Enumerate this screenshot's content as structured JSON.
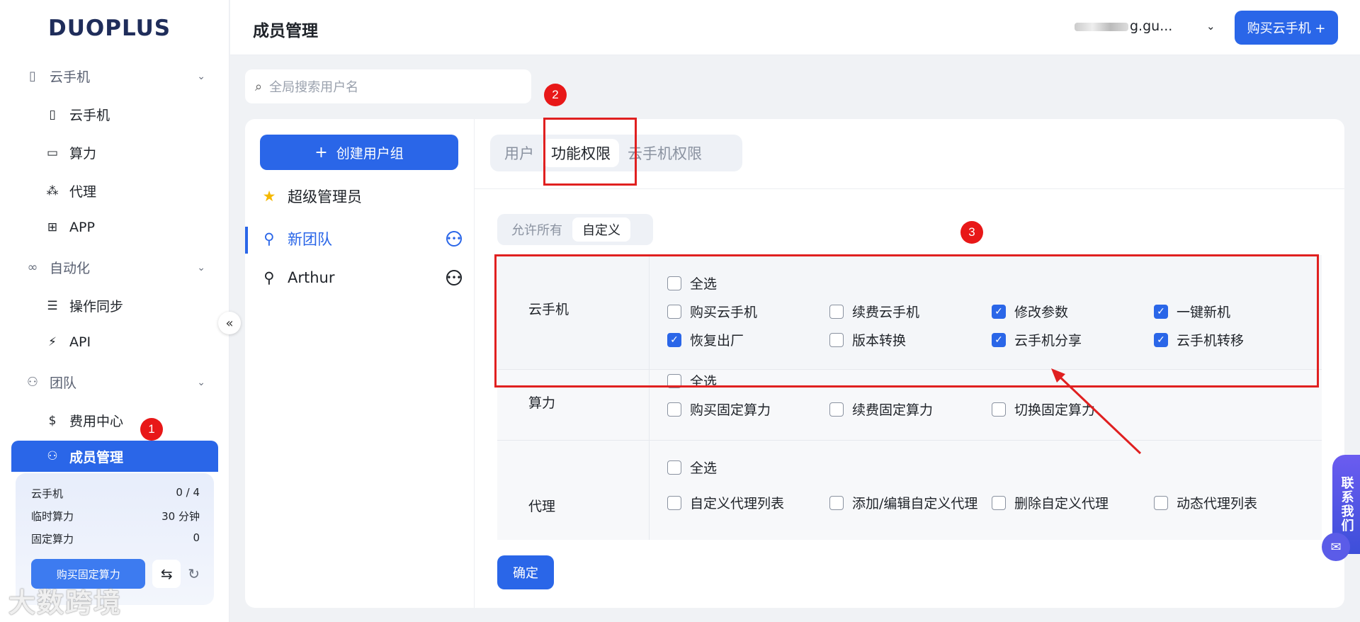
{
  "app": {
    "logo": "DUOPLUS"
  },
  "sidebar": {
    "groups": [
      {
        "label": "云手机",
        "items": [
          {
            "label": "云手机"
          },
          {
            "label": "算力"
          },
          {
            "label": "代理"
          },
          {
            "label": "APP"
          }
        ]
      },
      {
        "label": "自动化",
        "items": [
          {
            "label": "操作同步"
          },
          {
            "label": "API"
          }
        ]
      },
      {
        "label": "团队",
        "items": [
          {
            "label": "费用中心"
          },
          {
            "label": "成员管理"
          }
        ]
      }
    ],
    "collapse_icon": "«"
  },
  "quota": {
    "rows": [
      {
        "label": "云手机",
        "value": "0 / 4"
      },
      {
        "label": "临时算力",
        "value": "30 分钟"
      },
      {
        "label": "固定算力",
        "value": "0"
      }
    ],
    "buy_label": "购买固定算力"
  },
  "watermark": "大数跨境",
  "header": {
    "title": "成员管理",
    "account": "g.gu...",
    "buy_label": "购买云手机 +"
  },
  "search": {
    "placeholder": "全局搜索用户名"
  },
  "groups_panel": {
    "create_label": "创建用户组",
    "groups": [
      {
        "name": "超级管理员"
      },
      {
        "name": "新团队"
      },
      {
        "name": "Arthur"
      }
    ]
  },
  "tabs": [
    {
      "label": "用户"
    },
    {
      "label": "功能权限"
    },
    {
      "label": "云手机权限"
    }
  ],
  "mode": [
    {
      "label": "允许所有"
    },
    {
      "label": "自定义"
    }
  ],
  "permissions": {
    "select_all_label": "全选",
    "sections": [
      {
        "name": "云手机",
        "options": [
          {
            "label": "购买云手机",
            "checked": false
          },
          {
            "label": "续费云手机",
            "checked": false
          },
          {
            "label": "修改参数",
            "checked": true
          },
          {
            "label": "一键新机",
            "checked": true
          },
          {
            "label": "恢复出厂",
            "checked": true
          },
          {
            "label": "版本转换",
            "checked": false
          },
          {
            "label": "云手机分享",
            "checked": true
          },
          {
            "label": "云手机转移",
            "checked": true
          }
        ]
      },
      {
        "name": "算力",
        "options": [
          {
            "label": "购买固定算力",
            "checked": false
          },
          {
            "label": "续费固定算力",
            "checked": false
          },
          {
            "label": "切换固定算力",
            "checked": false
          }
        ]
      },
      {
        "name": "代理",
        "options": [
          {
            "label": "自定义代理列表",
            "checked": false
          },
          {
            "label": "添加/编辑自定义代理",
            "checked": false
          },
          {
            "label": "删除自定义代理",
            "checked": false
          },
          {
            "label": "动态代理列表",
            "checked": false
          }
        ]
      }
    ]
  },
  "confirm_label": "确定",
  "annotations": [
    {
      "label": "1"
    },
    {
      "label": "2"
    },
    {
      "label": "3"
    }
  ],
  "contact_label": "联系我们",
  "colors": {
    "primary": "#2a66e8",
    "annotation": "#e02020"
  }
}
